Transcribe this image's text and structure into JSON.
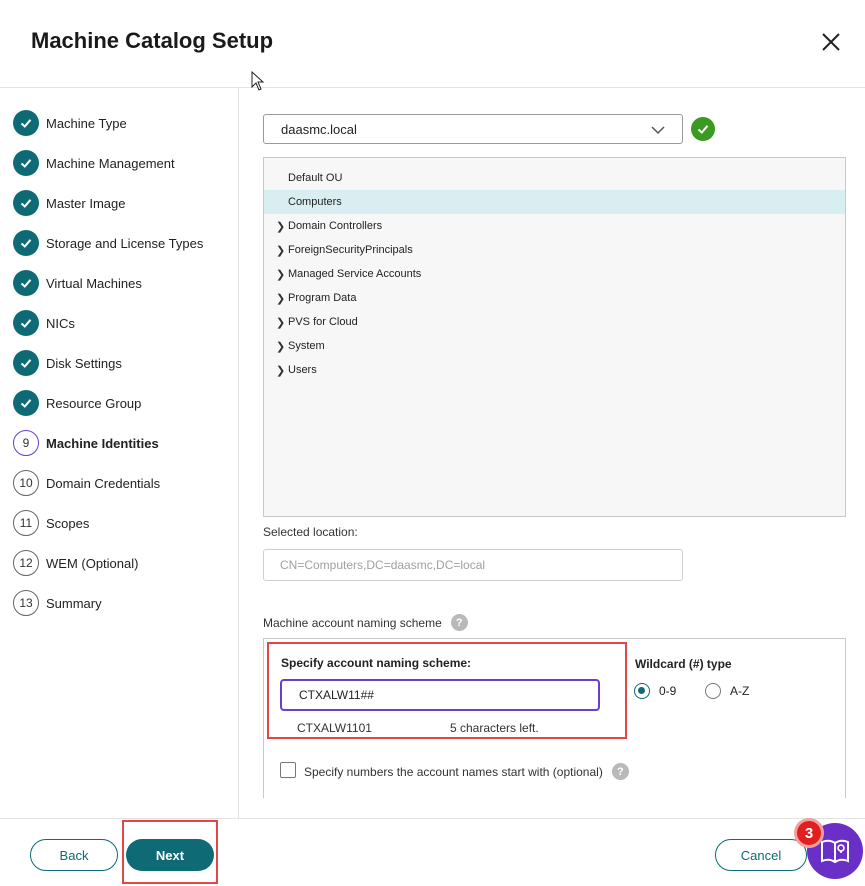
{
  "header": {
    "title": "Machine Catalog Setup"
  },
  "sidebar": {
    "steps": [
      {
        "label": "Machine Type",
        "state": "done"
      },
      {
        "label": "Machine Management",
        "state": "done"
      },
      {
        "label": "Master Image",
        "state": "done"
      },
      {
        "label": "Storage and License Types",
        "state": "done"
      },
      {
        "label": "Virtual Machines",
        "state": "done"
      },
      {
        "label": "NICs",
        "state": "done"
      },
      {
        "label": "Disk Settings",
        "state": "done"
      },
      {
        "label": "Resource Group",
        "state": "done"
      },
      {
        "label": "Machine Identities",
        "state": "active",
        "number": "9"
      },
      {
        "label": "Domain Credentials",
        "state": "pending",
        "number": "10"
      },
      {
        "label": "Scopes",
        "state": "pending",
        "number": "11"
      },
      {
        "label": "WEM (Optional)",
        "state": "pending",
        "number": "12"
      },
      {
        "label": "Summary",
        "state": "pending",
        "number": "13"
      }
    ]
  },
  "domain": {
    "value": "daasmc.local",
    "status_icon": "check-icon"
  },
  "ou_tree": {
    "items": [
      {
        "label": "Default OU",
        "expandable": false
      },
      {
        "label": "Computers",
        "expandable": false,
        "selected": true
      },
      {
        "label": "Domain Controllers",
        "expandable": true
      },
      {
        "label": "ForeignSecurityPrincipals",
        "expandable": true
      },
      {
        "label": "Managed Service Accounts",
        "expandable": true
      },
      {
        "label": "Program Data",
        "expandable": true
      },
      {
        "label": "PVS for Cloud",
        "expandable": true
      },
      {
        "label": "System",
        "expandable": true
      },
      {
        "label": "Users",
        "expandable": true
      }
    ]
  },
  "selected_location": {
    "label": "Selected location:",
    "placeholder": "CN=Computers,DC=daasmc,DC=local"
  },
  "naming": {
    "section_label": "Machine account naming scheme",
    "help_glyph": "?",
    "specify_label": "Specify account naming scheme:",
    "scheme_value": "CTXALW11##",
    "preview": "CTXALW1101",
    "chars_left": "5 characters left.",
    "wildcard_label": "Wildcard (#) type",
    "wildcard_options": [
      {
        "label": "0-9",
        "selected": true
      },
      {
        "label": "A-Z",
        "selected": false
      }
    ],
    "start_numbers_label": "Specify numbers the account names start with (optional)"
  },
  "footer": {
    "back_label": "Back",
    "next_label": "Next",
    "cancel_label": "Cancel",
    "guide_badge": "3"
  },
  "colors": {
    "accent": "#0e6a75",
    "active_step": "#6b3fc7",
    "highlight": "#e04848",
    "success": "#3b9a22",
    "guide": "#6a2fc6"
  }
}
